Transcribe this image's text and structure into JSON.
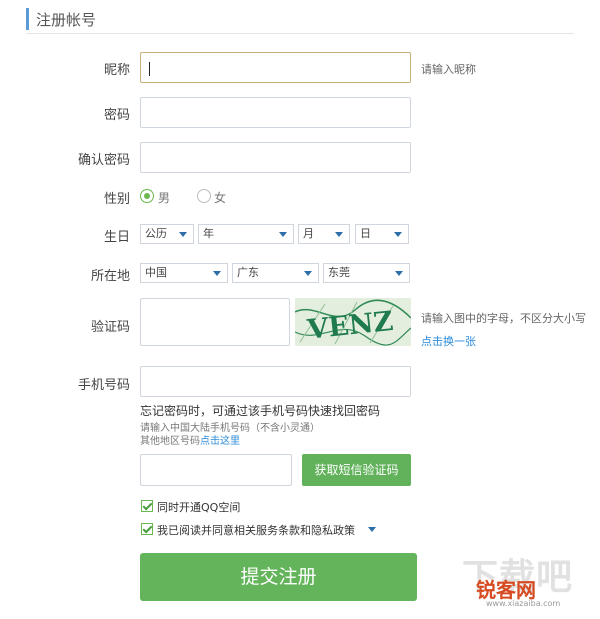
{
  "header": {
    "title": "注册帐号"
  },
  "form": {
    "nickname": {
      "label": "昵称",
      "value": "",
      "hint": "请输入昵称"
    },
    "password": {
      "label": "密码",
      "value": ""
    },
    "confirm_password": {
      "label": "确认密码",
      "value": ""
    },
    "gender": {
      "label": "性别",
      "options": [
        "男",
        "女"
      ],
      "selected": "男"
    },
    "birthday": {
      "label": "生日",
      "calendar": "公历",
      "year": "年",
      "month": "月",
      "day": "日"
    },
    "location": {
      "label": "所在地",
      "country": "中国",
      "province": "广东",
      "city": "东莞"
    },
    "captcha": {
      "label": "验证码",
      "value": "",
      "hint": "请输入图中的字母，不区分大小写",
      "refresh_link": "点击换一张",
      "image_text": "VENZ"
    },
    "phone": {
      "label": "手机号码",
      "value": "",
      "note": "忘记密码时，可通过该手机号码快速找回密码",
      "subnote1": "请输入中国大陆手机号码（不含小灵通）",
      "subnote2_prefix": "其他地区号码",
      "subnote2_link": "点击这里"
    },
    "sms": {
      "value": "",
      "button": "获取短信验证码"
    },
    "options": {
      "qzone": {
        "label": "同时开通QQ空间",
        "checked": true
      },
      "agreement": {
        "label": "我已阅读并同意相关服务条款和隐私政策",
        "checked": true
      }
    },
    "submit": "提交注册"
  },
  "watermark": {
    "text1": "下载吧",
    "text2": "锐客网",
    "url": "www.xiazaiba.com"
  },
  "colors": {
    "accent_green": "#63b45a",
    "link_blue": "#2d8cd9",
    "header_bar": "#5b9bd5"
  }
}
